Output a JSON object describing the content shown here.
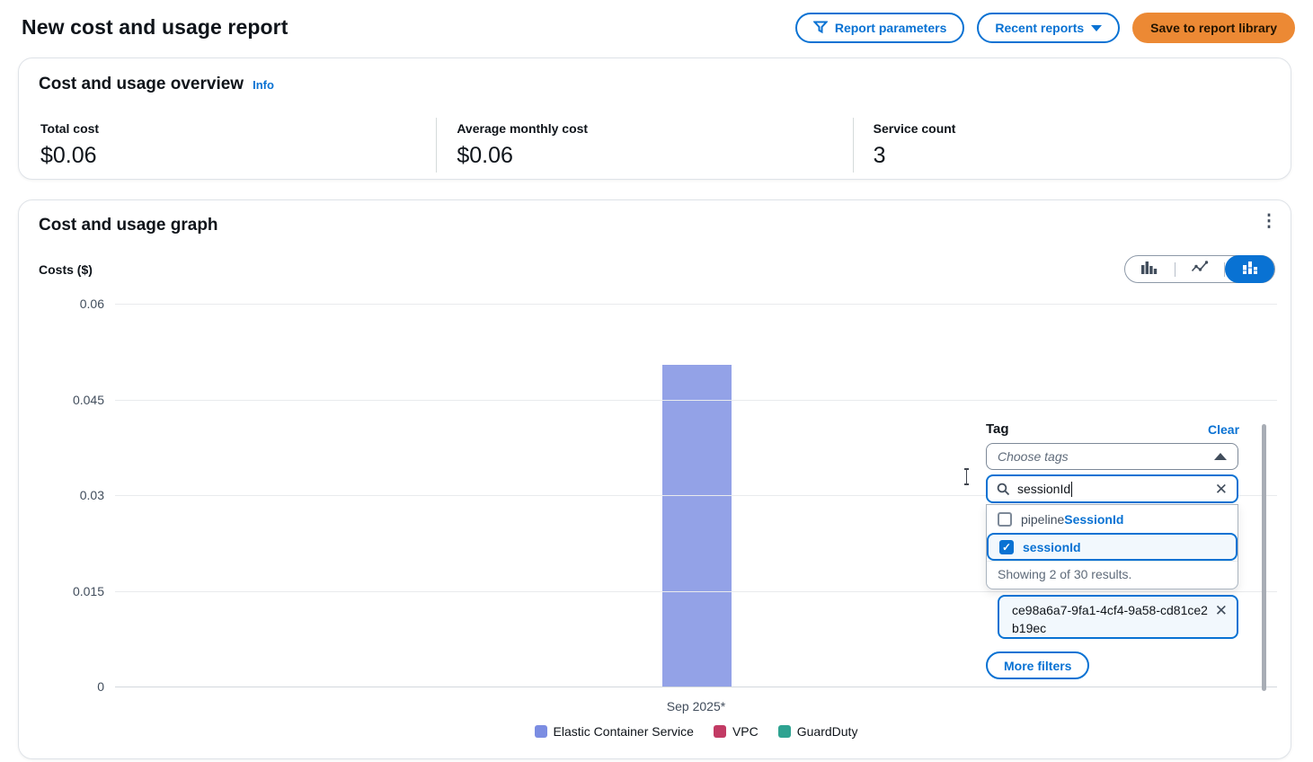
{
  "page": {
    "title": "New cost and usage report"
  },
  "toolbar": {
    "report_parameters_label": "Report parameters",
    "recent_reports_label": "Recent reports",
    "save_label": "Save to report library"
  },
  "overview": {
    "title": "Cost and usage overview",
    "info_label": "Info",
    "metrics": [
      {
        "label": "Total cost",
        "value": "$0.06"
      },
      {
        "label": "Average monthly cost",
        "value": "$0.06"
      },
      {
        "label": "Service count",
        "value": "3"
      }
    ]
  },
  "graph_card": {
    "title": "Cost and usage graph",
    "kebab_icon": "⋮"
  },
  "chart_data": {
    "type": "bar",
    "stacked": true,
    "title": "Cost and usage graph",
    "ylabel": "Costs ($)",
    "categories": [
      "Sep 2025*"
    ],
    "series": [
      {
        "name": "Elastic Container Service",
        "values": [
          0.05
        ],
        "color": "#7b8de2"
      },
      {
        "name": "VPC",
        "values": [
          0.0002
        ],
        "color": "#c23a64"
      },
      {
        "name": "GuardDuty",
        "values": [
          0.0002
        ],
        "color": "#2ea391"
      }
    ],
    "ylim": [
      0,
      0.06
    ],
    "yticks": [
      0,
      0.015,
      0.03,
      0.045,
      0.06
    ],
    "ytick_labels": [
      "0",
      "0.015",
      "0.03",
      "0.045",
      "0.06"
    ],
    "grid": true,
    "legend_position": "bottom"
  },
  "filters": {
    "tag_label": "Tag",
    "clear_label": "Clear",
    "choose_tags_placeholder": "Choose tags",
    "search_value": "sessionId",
    "search_icon": "search-icon",
    "options": [
      {
        "prefix": "pipeline",
        "match": "SessionId",
        "checked": false
      },
      {
        "prefix": "",
        "match": "sessionId",
        "checked": true
      }
    ],
    "results_text": "Showing 2 of 30 results.",
    "selected_token": "ce98a6a7-9fa1-4cf4-9a58-cd81ce2b19ec",
    "more_filters_label": "More filters",
    "dismiss_icon": "✕",
    "check_glyph": "✓"
  }
}
